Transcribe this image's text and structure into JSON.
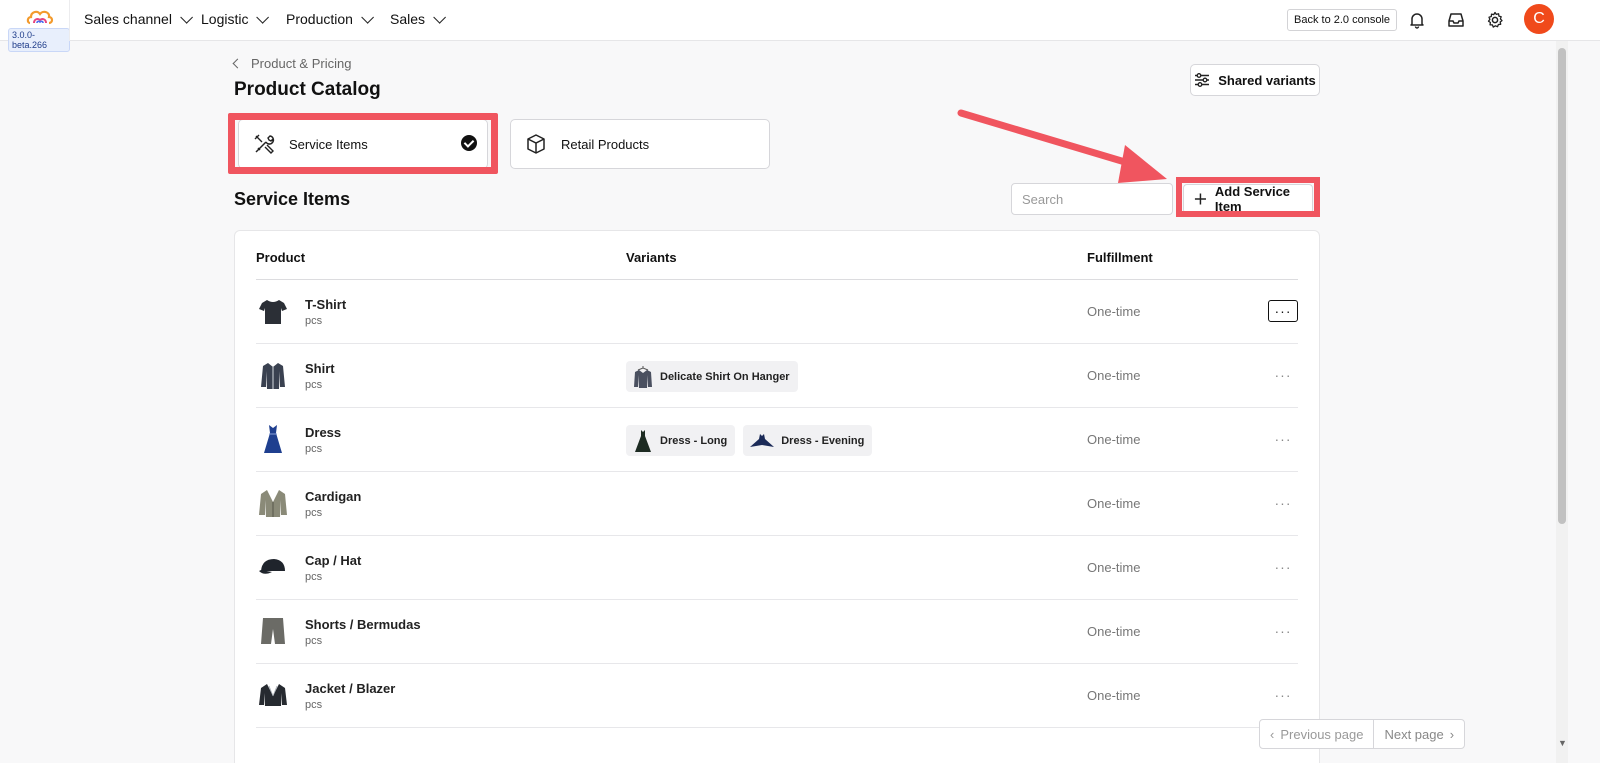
{
  "topbar": {
    "version": "3.0.0-beta.266",
    "nav": [
      {
        "label": "Sales channel"
      },
      {
        "label": "Logistic"
      },
      {
        "label": "Production"
      },
      {
        "label": "Sales"
      }
    ],
    "back_label": "Back to 2.0 console",
    "avatar_letter": "C",
    "icons": [
      "bell-icon",
      "inbox-icon",
      "gear-icon"
    ]
  },
  "header": {
    "breadcrumb": "Product & Pricing",
    "title": "Product Catalog",
    "shared_variants_label": "Shared variants"
  },
  "tabs": [
    {
      "label": "Service Items",
      "selected": true,
      "icon": "tools-icon"
    },
    {
      "label": "Retail Products",
      "selected": false,
      "icon": "box-icon"
    }
  ],
  "section": {
    "title": "Service Items",
    "search_placeholder": "Search",
    "add_label": "Add Service Item"
  },
  "table": {
    "columns": [
      "Product",
      "Variants",
      "Fulfillment"
    ],
    "rows": [
      {
        "name": "T-Shirt",
        "unit": "pcs",
        "variants": [],
        "fulfillment": "One-time",
        "icon": "tshirt-icon"
      },
      {
        "name": "Shirt",
        "unit": "pcs",
        "variants": [
          "Delicate Shirt On Hanger"
        ],
        "fulfillment": "One-time",
        "icon": "shirt-icon"
      },
      {
        "name": "Dress",
        "unit": "pcs",
        "variants": [
          "Dress - Long",
          "Dress - Evening"
        ],
        "fulfillment": "One-time",
        "icon": "dress-icon"
      },
      {
        "name": "Cardigan",
        "unit": "pcs",
        "variants": [],
        "fulfillment": "One-time",
        "icon": "cardigan-icon"
      },
      {
        "name": "Cap / Hat",
        "unit": "pcs",
        "variants": [],
        "fulfillment": "One-time",
        "icon": "cap-icon"
      },
      {
        "name": "Shorts / Bermudas",
        "unit": "pcs",
        "variants": [],
        "fulfillment": "One-time",
        "icon": "shorts-icon"
      },
      {
        "name": "Jacket / Blazer",
        "unit": "pcs",
        "variants": [],
        "fulfillment": "One-time",
        "icon": "jacket-icon"
      }
    ],
    "menu_glyph": "···"
  },
  "pagination": {
    "prev_label": "Previous page",
    "next_label": "Next page"
  },
  "colors": {
    "highlight": "#f0555f",
    "avatar": "#f04a1b"
  }
}
